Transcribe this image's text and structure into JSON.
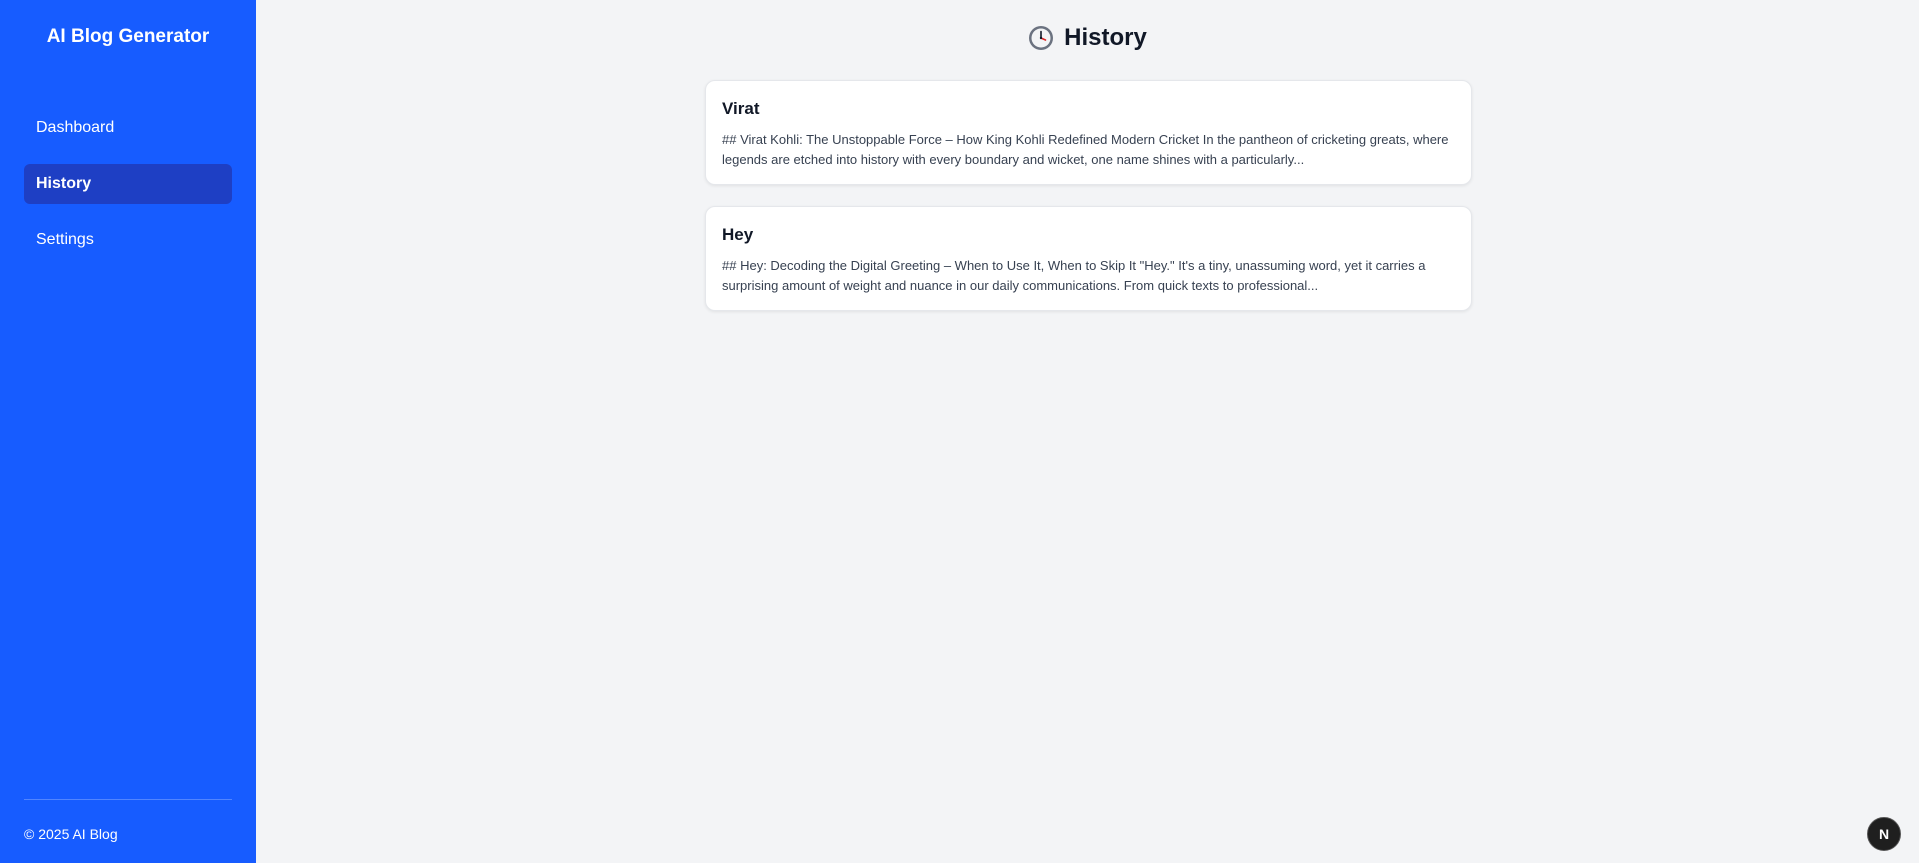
{
  "sidebar": {
    "brand": "AI Blog Generator",
    "items": [
      {
        "label": "Dashboard",
        "active": false
      },
      {
        "label": "History",
        "active": true
      },
      {
        "label": "Settings",
        "active": false
      }
    ],
    "footer": "© 2025 AI Blog"
  },
  "header": {
    "icon": "clock-icon",
    "title": "History"
  },
  "cards": [
    {
      "title": "Virat",
      "snippet": "## Virat Kohli: The Unstoppable Force – How King Kohli Redefined Modern Cricket In the pantheon of cricketing greats, where legends are etched into history with every boundary and wicket, one name shines with a particularly..."
    },
    {
      "title": "Hey",
      "snippet": "## Hey: Decoding the Digital Greeting – When to Use It, When to Skip It \"Hey.\" It's a tiny, unassuming word, yet it carries a surprising amount of weight and nuance in our daily communications. From quick texts to professional..."
    }
  ],
  "badge": {
    "label": "N"
  },
  "colors": {
    "sidebar": "#175cff",
    "active_item": "#1e3fc4",
    "background": "#f3f4f6"
  }
}
